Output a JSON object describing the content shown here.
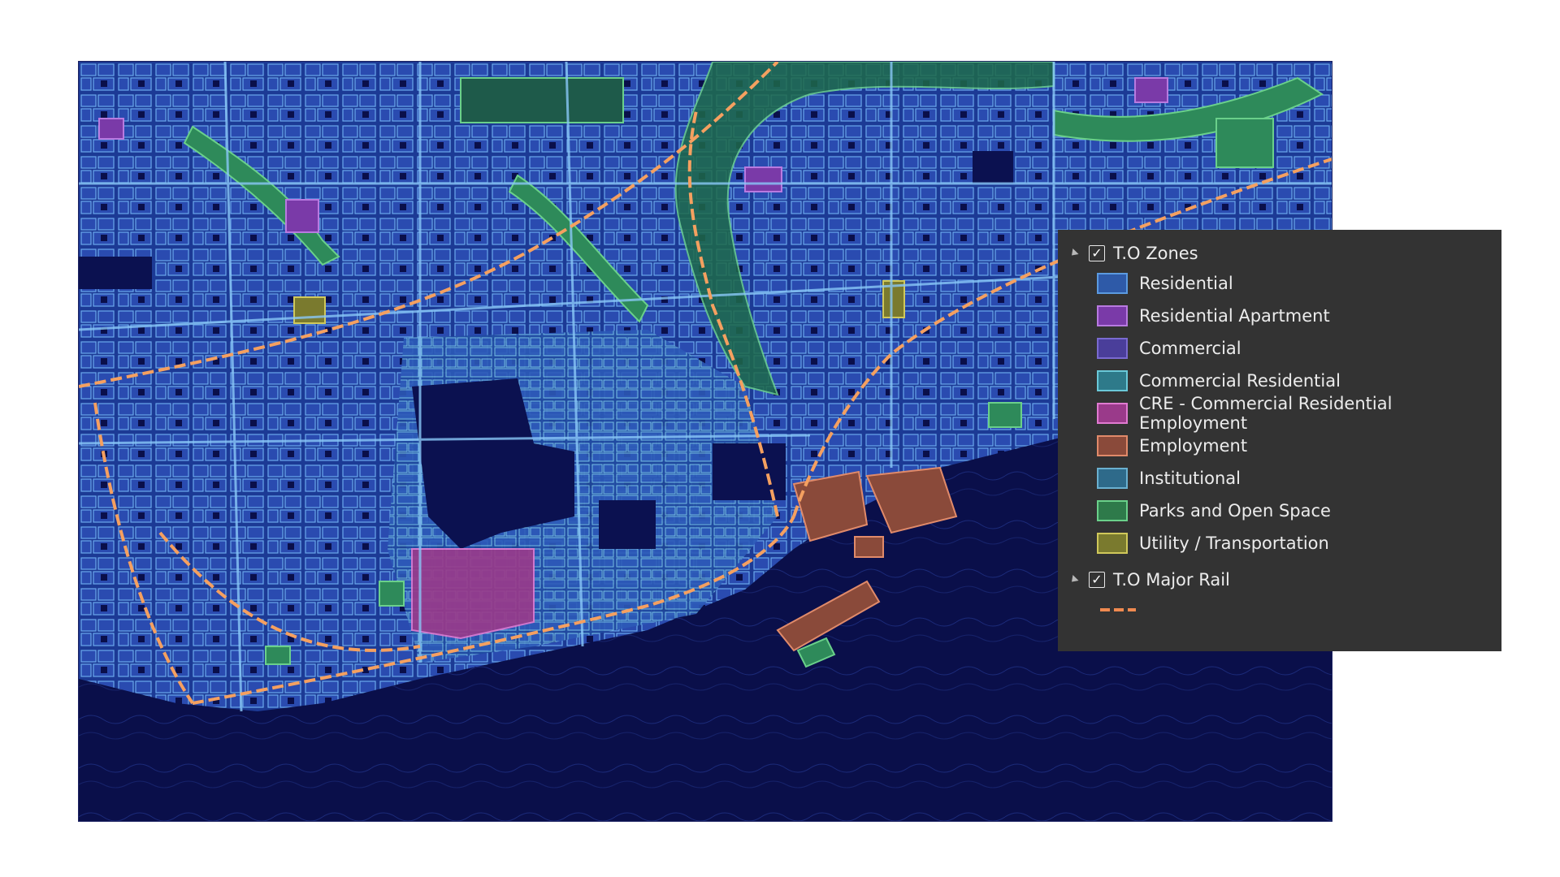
{
  "legend": {
    "layers": [
      {
        "title": "T.O Zones",
        "checked": true,
        "items": [
          {
            "label": "Residential",
            "fill": "#2e5aa8",
            "stroke": "#5b9ae0"
          },
          {
            "label": "Residential Apartment",
            "fill": "#7a3aa8",
            "stroke": "#b87ae0"
          },
          {
            "label": "Commercial",
            "fill": "#4a3e9a",
            "stroke": "#7a6ad0"
          },
          {
            "label": "Commercial Residential",
            "fill": "#2e7a8a",
            "stroke": "#6ac8d8"
          },
          {
            "label": "CRE - Commercial Residential Employment",
            "fill": "#9a3a8a",
            "stroke": "#e07ad0"
          },
          {
            "label": "Employment",
            "fill": "#8a4a3a",
            "stroke": "#e08a6a"
          },
          {
            "label": "Institutional",
            "fill": "#2e6a8a",
            "stroke": "#6ab0d0"
          },
          {
            "label": "Parks and Open Space",
            "fill": "#2e7a4a",
            "stroke": "#6ad08a"
          },
          {
            "label": "Utility / Transportation",
            "fill": "#7a7a2e",
            "stroke": "#d0c85a"
          }
        ]
      },
      {
        "title": "T.O Major Rail",
        "checked": true,
        "symbol_color": "#f08a50"
      }
    ]
  },
  "map": {
    "background": "#0a0f4a",
    "block_color": "#2848a8",
    "street_color": "#7ab8f0",
    "park_color": "#2e8a5a",
    "rail_color": "#f5a060"
  }
}
